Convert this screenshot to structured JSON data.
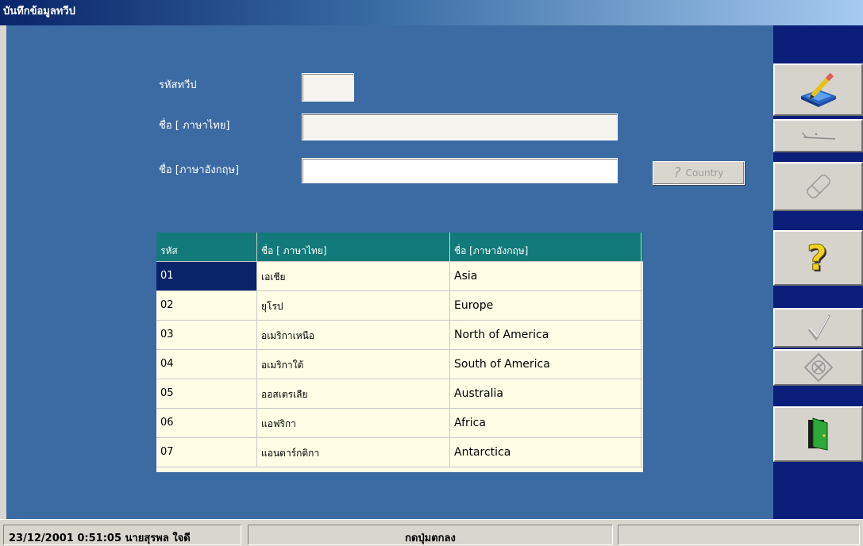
{
  "window": {
    "title": "บันทึกข้อมูลทวีป"
  },
  "form": {
    "code_label": "รหัสทวีป",
    "code_value": "",
    "name_th_label": "ชื่อ [ ภาษาไทย]",
    "name_th_value": "",
    "name_en_label": "ชื่อ [ภาษาอังกฤษ]",
    "name_en_value": "",
    "country_button_label": "Country",
    "country_button_icon": "question-icon"
  },
  "grid": {
    "headers": [
      "รหัส",
      "ชื่อ [ ภาษาไทย]",
      "ชื่อ [ภาษาอังกฤษ]"
    ],
    "rows": [
      {
        "code": "01",
        "name_th": "เอเชีย",
        "name_en": "Asia"
      },
      {
        "code": "02",
        "name_th": "ยุโรป",
        "name_en": "Europe"
      },
      {
        "code": "03",
        "name_th": "อเมริกาเหนือ",
        "name_en": "North of America"
      },
      {
        "code": "04",
        "name_th": "อเมริกาใต้",
        "name_en": "South of America"
      },
      {
        "code": "05",
        "name_th": "ออสเตรเลีย",
        "name_en": "Australia"
      },
      {
        "code": "06",
        "name_th": "แอฟริกา",
        "name_en": "Africa"
      },
      {
        "code": "07",
        "name_th": "แอนตาร์กติกา",
        "name_en": "Antarctica"
      }
    ],
    "selected_row_code": "01",
    "header_color": "#127a7a",
    "selected_color": "#0a246a"
  },
  "toolbar": {
    "buttons": [
      {
        "icon": "edit-icon",
        "enabled": true
      },
      {
        "icon": "clear-icon",
        "enabled": false
      },
      {
        "icon": "eraser-icon",
        "enabled": false
      },
      {
        "icon": "help-icon",
        "enabled": true
      },
      {
        "icon": "confirm-icon",
        "enabled": false
      },
      {
        "icon": "cancel-icon",
        "enabled": false
      },
      {
        "icon": "exit-icon",
        "enabled": true
      }
    ]
  },
  "status": {
    "datetime_user": "23/12/2001 0:51:05 นายสุรพล  ใจดี",
    "message": "กดปุ่มตกลง",
    "extra": ""
  },
  "colors": {
    "form_background": "#3c6aa3",
    "toolbar_background": "#0a1e7a",
    "grid_background": "#fffde6"
  }
}
